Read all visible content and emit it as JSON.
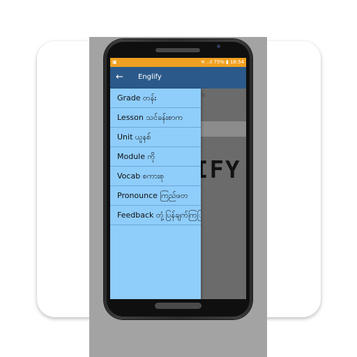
{
  "status_bar": {
    "battery": "75%",
    "time": "18:54",
    "signal": "..ıl"
  },
  "app_bar": {
    "back_icon": "arrow-left-icon",
    "title": "Englify"
  },
  "main": {
    "strip_text": "!!!",
    "big_word": "IFY"
  },
  "drawer": {
    "items": [
      {
        "label": "Grade တန်း"
      },
      {
        "label": "Lesson သင်ခန်းစာက"
      },
      {
        "label": "Unit ယူနစ်"
      },
      {
        "label": "Module ကို"
      },
      {
        "label": "Vocab စကားစု"
      },
      {
        "label": "Pronounce ကြည်ဖတ"
      },
      {
        "label": "Feedback တုံ့ပြန်ချက်ကြြ"
      }
    ]
  },
  "colors": {
    "status_bar": "#f0a020",
    "app_bar": "#2b5a8a",
    "drawer": "#8fcdfb"
  }
}
